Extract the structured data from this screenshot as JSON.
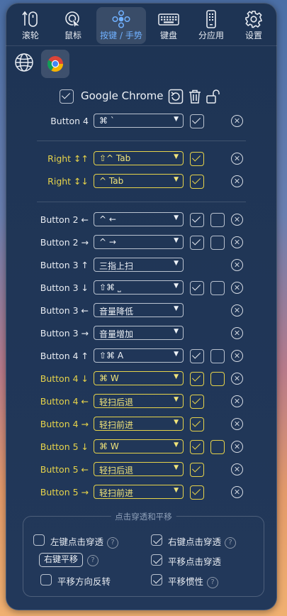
{
  "toolbar": {
    "items": [
      {
        "label": "滚轮",
        "icon": "scroll-wheel-icon"
      },
      {
        "label": "鼠标",
        "icon": "mouse-cursor-icon"
      },
      {
        "label": "按键 / 手势",
        "icon": "buttons-gesture-icon",
        "active": true
      },
      {
        "label": "键盘",
        "icon": "keyboard-icon"
      },
      {
        "label": "分应用",
        "icon": "phone-app-icon"
      },
      {
        "label": "设置",
        "icon": "gear-icon"
      }
    ]
  },
  "app": {
    "name": "Google Chrome",
    "enabled": true
  },
  "rows": [
    {
      "label": "Button 4",
      "shortcut": "⌘ `",
      "highlight": false,
      "check1": true,
      "check2": null
    },
    {
      "label": "Right ↕↑",
      "shortcut": "⇧^ Tab",
      "highlight": true,
      "check1": true,
      "check2": null
    },
    {
      "label": "Right ↕↓",
      "shortcut": "^ Tab",
      "highlight": true,
      "check1": true,
      "check2": null
    },
    {
      "label": "Button 2 ←",
      "shortcut": "^ ←",
      "highlight": false,
      "check1": true,
      "check2": false
    },
    {
      "label": "Button 2 →",
      "shortcut": "^ →",
      "highlight": false,
      "check1": true,
      "check2": false
    },
    {
      "label": "Button 3 ↑",
      "shortcut": "三指上扫",
      "highlight": false,
      "check1": null,
      "check2": null
    },
    {
      "label": "Button 3 ↓",
      "shortcut": "⇧⌘ ⎵",
      "highlight": false,
      "check1": true,
      "check2": false
    },
    {
      "label": "Button 3 ←",
      "shortcut": "音量降低",
      "highlight": false,
      "check1": null,
      "check2": null
    },
    {
      "label": "Button 3 →",
      "shortcut": "音量增加",
      "highlight": false,
      "check1": null,
      "check2": null
    },
    {
      "label": "Button 4 ↑",
      "shortcut": "⇧⌘ A",
      "highlight": false,
      "check1": true,
      "check2": false
    },
    {
      "label": "Button 4 ↓",
      "shortcut": "⌘ W",
      "highlight": true,
      "check1": true,
      "check2": false
    },
    {
      "label": "Button 4 ←",
      "shortcut": "轻扫后退",
      "highlight": true,
      "check1": true,
      "check2": null
    },
    {
      "label": "Button 4 →",
      "shortcut": "轻扫前进",
      "highlight": true,
      "check1": true,
      "check2": null
    },
    {
      "label": "Button 5 ↓",
      "shortcut": "⌘ W",
      "highlight": true,
      "check1": true,
      "check2": false
    },
    {
      "label": "Button 5 ←",
      "shortcut": "轻扫后退",
      "highlight": true,
      "check1": true,
      "check2": null
    },
    {
      "label": "Button 5 →",
      "shortcut": "轻扫前进",
      "highlight": true,
      "check1": true,
      "check2": null
    }
  ],
  "options": {
    "legend": "点击穿透和平移",
    "left_click_passthrough": {
      "label": "左键点击穿透",
      "checked": false,
      "help": "?"
    },
    "right_click_passthrough": {
      "label": "右键点击穿透",
      "checked": true,
      "help": "?"
    },
    "right_pan_button": {
      "label": "右键平移",
      "help": "?"
    },
    "pan_click_passthrough": {
      "label": "平移点击穿透",
      "checked": true
    },
    "pan_reverse": {
      "label": "平移方向反转",
      "checked": false
    },
    "pan_inertia": {
      "label": "平移惯性",
      "checked": true,
      "help": "?"
    }
  }
}
